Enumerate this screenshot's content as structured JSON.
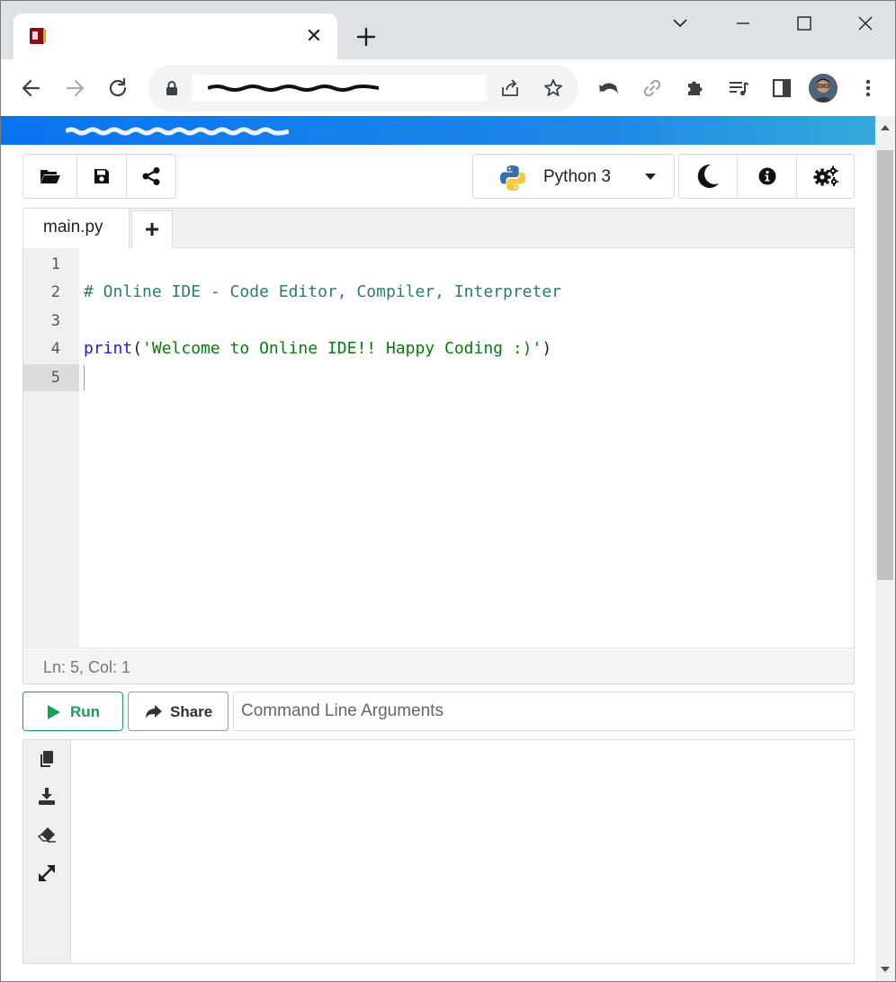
{
  "browser": {
    "tab": {
      "title": "",
      "close_glyph": "✕",
      "favicon": "site-favicon"
    },
    "new_tab_glyph": "+",
    "window_controls": [
      "chevron-down-icon",
      "minimize-icon",
      "maximize-icon",
      "close-icon"
    ],
    "toolbar_icons": [
      "back-icon",
      "forward-icon",
      "reload-icon",
      "lock-icon",
      "share-page-icon",
      "star-icon",
      "extension-undo-icon",
      "link-icon",
      "puzzle-icon",
      "reading-list-icon",
      "side-panel-icon",
      "avatar",
      "kebab-menu-icon"
    ]
  },
  "ide": {
    "file_actions": [
      "folder-open-icon",
      "save-icon",
      "share-nodes-icon"
    ],
    "language": {
      "label": "Python 3",
      "icon": "python-icon"
    },
    "right_actions": [
      "moon-icon",
      "info-icon",
      "gears-icon"
    ],
    "file_tab": "main.py",
    "add_tab_glyph": "+",
    "line_numbers": [
      "1",
      "2",
      "3",
      "4",
      "5"
    ],
    "code": {
      "line2_comment": "# Online IDE - Code Editor, Compiler, Interpreter",
      "line4_kw": "print",
      "line4_open": "(",
      "line4_str": "'Welcome to Online IDE!! Happy Coding :)'",
      "line4_close": ")"
    },
    "status": "Ln: 5,  Col: 1",
    "run_label": "Run",
    "share_label": "Share",
    "args_placeholder": "Command Line Arguments",
    "output_tools": [
      "copy-icon",
      "download-icon",
      "eraser-icon",
      "expand-icon"
    ]
  },
  "colors": {
    "banner_start": "#0a73f0",
    "banner_end": "#35a9dc",
    "run_green": "#1a9f57"
  }
}
